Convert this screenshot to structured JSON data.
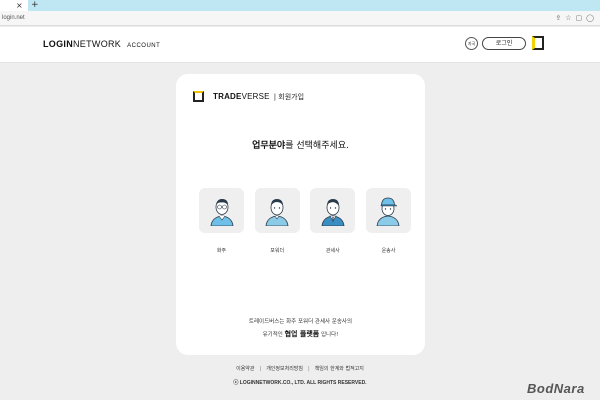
{
  "browser": {
    "tab_close": "×",
    "new_tab": "+",
    "url": "login.net",
    "icons": [
      "share-icon",
      "star-icon",
      "extensions-icon",
      "profile-icon"
    ]
  },
  "header": {
    "logo_bold": "LOGIN",
    "logo_thin": "NETWORK",
    "logo_sub": "ACCOUNT",
    "lang_label": "지국",
    "login_label": "로그인",
    "accent_color": "#f2d200"
  },
  "card": {
    "brand_bold": "TRADE",
    "brand_light": "VERSE",
    "brand_suffix": "| 회원가입",
    "headline_bold": "업무분야",
    "headline_rest": "를 선택해주세요.",
    "roles": [
      {
        "label": "화주"
      },
      {
        "label": "포워더"
      },
      {
        "label": "관세사"
      },
      {
        "label": "운송사"
      }
    ],
    "tagline_line1": "트레이드버스는 화주 포워더 관세사 운송사의",
    "tagline_pre": "유기적인 ",
    "tagline_bold": "협업 플랫폼",
    "tagline_post": " 입니다!"
  },
  "footer": {
    "links": [
      "이용약관",
      "개인정보처리방침",
      "책임의 한계와 법적고지"
    ],
    "separator": "|",
    "copyright": "ⓒ LOGINNETWORK.CO., LTD. ALL RIGHTS RESERVED."
  },
  "watermark": "BodNara"
}
